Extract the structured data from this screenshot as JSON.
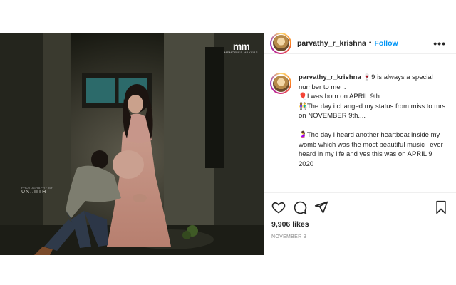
{
  "photo": {
    "watermark": "mm",
    "watermark_sub": "MEMORIES MAKERS",
    "credit_small": "PHOTOGRAPHY BY",
    "credit": "UN..IITH"
  },
  "header": {
    "username": "parvathy_r_krishna",
    "separator": "•",
    "follow_label": "Follow",
    "more_label": "•••"
  },
  "caption": {
    "username": "parvathy_r_krishna",
    "lines": [
      "9 is always a special number to me ..",
      "I was born on APRIL 9th...",
      "The day i changed my status from miss to mrs on NOVEMBER 9th....",
      "The day i heard another heartbeat inside my womb which was the most beautiful music i ever heard in my life and yes this was on APRIL 9 2020"
    ],
    "emojis": [
      "🍷",
      "🎈",
      "👫",
      "🤰"
    ]
  },
  "actions": {
    "icons": [
      "heart-icon",
      "comment-icon",
      "share-icon",
      "bookmark-icon"
    ],
    "likes": "9,906 likes",
    "date": "NOVEMBER 9"
  }
}
